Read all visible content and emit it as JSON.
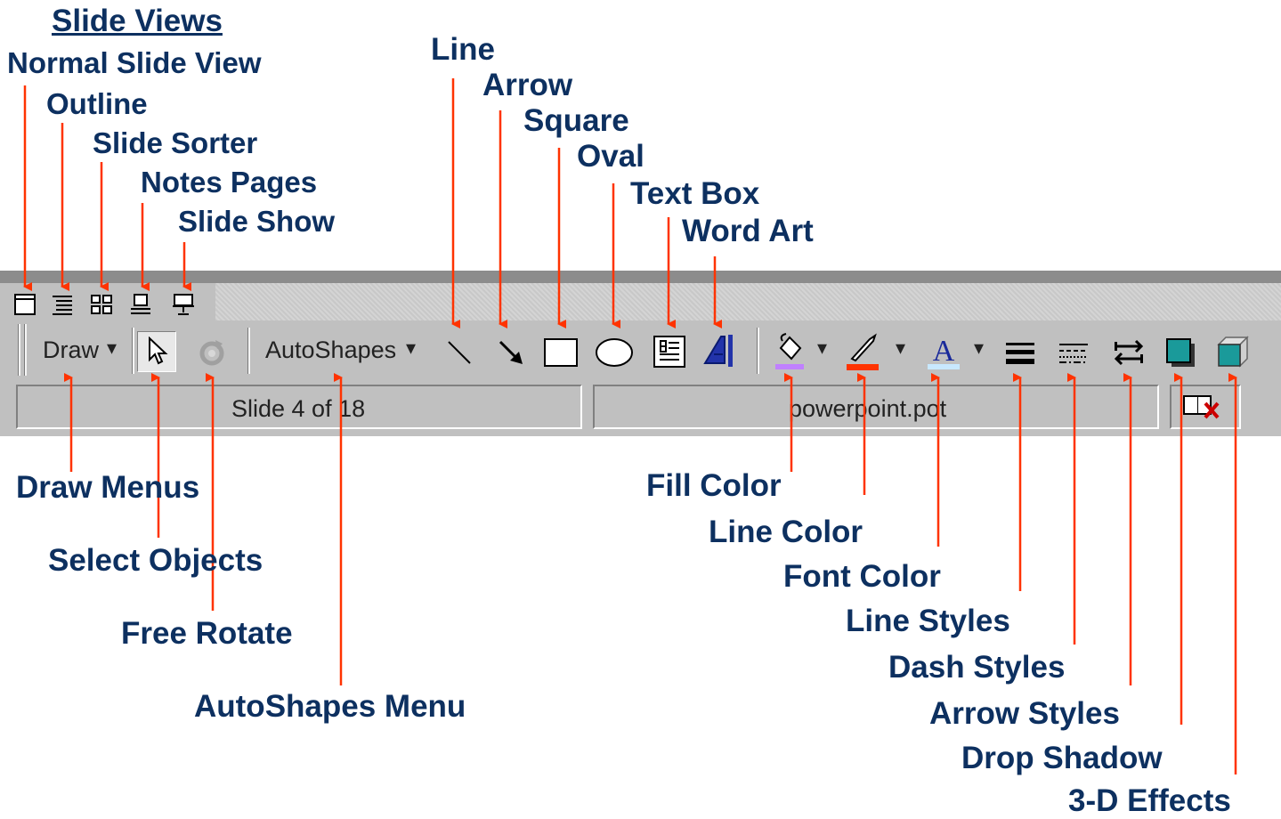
{
  "title": "Slide Views",
  "top_labels": {
    "normal": "Normal Slide View",
    "outline": "Outline",
    "sorter": "Slide Sorter",
    "notes": "Notes Pages",
    "show": "Slide Show",
    "line": "Line",
    "arrow": "Arrow",
    "square": "Square",
    "oval": "Oval",
    "textbox": "Text Box",
    "wordart": "Word Art"
  },
  "bottom_labels": {
    "draw_menus": "Draw Menus",
    "select_objects": "Select Objects",
    "free_rotate": "Free Rotate",
    "autoshapes_menu": "AutoShapes Menu",
    "fill_color": "Fill Color",
    "line_color": "Line Color",
    "font_color": "Font Color",
    "line_styles": "Line Styles",
    "dash_styles": "Dash Styles",
    "arrow_styles": "Arrow Styles",
    "drop_shadow": "Drop Shadow",
    "effects_3d": "3-D Effects"
  },
  "toolbar": {
    "draw_label": "Draw",
    "autoshapes_label": "AutoShapes",
    "dropdown_glyph": "▾"
  },
  "status": {
    "slide_info": "Slide 4 of 18",
    "template": "powerpoint.pot"
  },
  "colors": {
    "label": "#0d3060",
    "arrow": "#ff3300",
    "fill": "#c080ff",
    "line": "#ff3300",
    "font": "#1a2a9a",
    "teal": "#1a9a9a"
  }
}
